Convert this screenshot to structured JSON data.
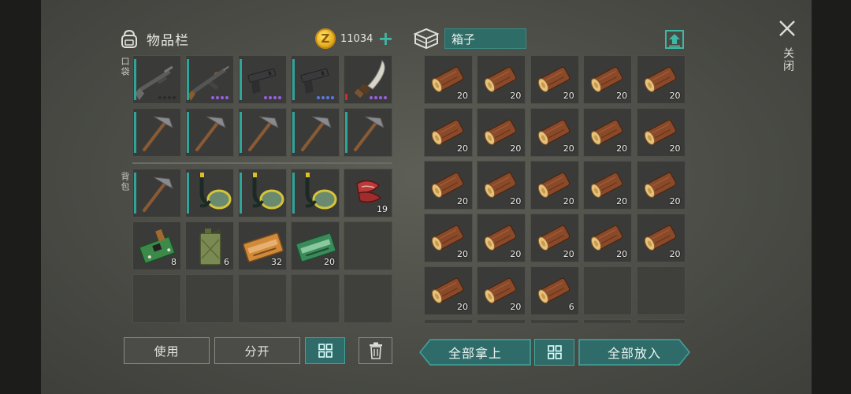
{
  "header": {
    "inventory_title": "物品栏",
    "coin_amount": "11034",
    "coin_symbol": "Z",
    "plus": "+"
  },
  "labels": {
    "pockets": "口袋",
    "backpack": "背包"
  },
  "pockets": [
    {
      "item": "shotgun-icon",
      "count": "",
      "dots": "dark"
    },
    {
      "item": "assault-rifle-icon",
      "count": "",
      "dots": "purple"
    },
    {
      "item": "pistol-icon",
      "count": "",
      "dots": "purple"
    },
    {
      "item": "pistol-icon",
      "count": "",
      "dots": "blue"
    },
    {
      "item": "machete-icon",
      "count": "",
      "dots": "purple"
    },
    {
      "item": "pickaxe-icon",
      "count": ""
    },
    {
      "item": "pickaxe-icon",
      "count": ""
    },
    {
      "item": "pickaxe-icon",
      "count": ""
    },
    {
      "item": "pickaxe-icon",
      "count": ""
    },
    {
      "item": "pickaxe-icon",
      "count": ""
    }
  ],
  "backpack": [
    {
      "item": "pickaxe-icon",
      "count": ""
    },
    {
      "item": "snorkel-mask-icon",
      "count": ""
    },
    {
      "item": "snorkel-mask-icon",
      "count": ""
    },
    {
      "item": "snorkel-mask-icon",
      "count": ""
    },
    {
      "item": "raw-meat-icon",
      "count": "19"
    },
    {
      "item": "circuit-board-icon",
      "count": "8"
    },
    {
      "item": "jerrycan-icon",
      "count": "6"
    },
    {
      "item": "coupon-orange-icon",
      "count": "32"
    },
    {
      "item": "coupon-green-icon",
      "count": "20"
    },
    {
      "item": "",
      "count": ""
    },
    {
      "item": "",
      "count": ""
    },
    {
      "item": "",
      "count": ""
    },
    {
      "item": "",
      "count": ""
    },
    {
      "item": "",
      "count": ""
    },
    {
      "item": "",
      "count": ""
    }
  ],
  "buttons": {
    "use": "使用",
    "split": "分开",
    "take_all": "全部拿上",
    "put_all": "全部放入",
    "close": "关闭"
  },
  "box": {
    "name": "箱子",
    "slots": [
      {
        "item": "log-icon",
        "count": "20"
      },
      {
        "item": "log-icon",
        "count": "20"
      },
      {
        "item": "log-icon",
        "count": "20"
      },
      {
        "item": "log-icon",
        "count": "20"
      },
      {
        "item": "log-icon",
        "count": "20"
      },
      {
        "item": "log-icon",
        "count": "20"
      },
      {
        "item": "log-icon",
        "count": "20"
      },
      {
        "item": "log-icon",
        "count": "20"
      },
      {
        "item": "log-icon",
        "count": "20"
      },
      {
        "item": "log-icon",
        "count": "20"
      },
      {
        "item": "log-icon",
        "count": "20"
      },
      {
        "item": "log-icon",
        "count": "20"
      },
      {
        "item": "log-icon",
        "count": "20"
      },
      {
        "item": "log-icon",
        "count": "20"
      },
      {
        "item": "log-icon",
        "count": "20"
      },
      {
        "item": "log-icon",
        "count": "20"
      },
      {
        "item": "log-icon",
        "count": "20"
      },
      {
        "item": "log-icon",
        "count": "20"
      },
      {
        "item": "log-icon",
        "count": "20"
      },
      {
        "item": "log-icon",
        "count": "20"
      },
      {
        "item": "log-icon",
        "count": "20"
      },
      {
        "item": "log-icon",
        "count": "20"
      },
      {
        "item": "log-icon",
        "count": "6"
      },
      {
        "item": "",
        "count": ""
      },
      {
        "item": "",
        "count": ""
      },
      {
        "item": "",
        "count": ""
      },
      {
        "item": "",
        "count": ""
      },
      {
        "item": "",
        "count": ""
      },
      {
        "item": "",
        "count": ""
      },
      {
        "item": "",
        "count": ""
      }
    ]
  },
  "colors": {
    "accent": "#2f6b68",
    "accent_border": "#3fa59d",
    "coin": "#e3a81a",
    "durability": "#2fa59a"
  }
}
